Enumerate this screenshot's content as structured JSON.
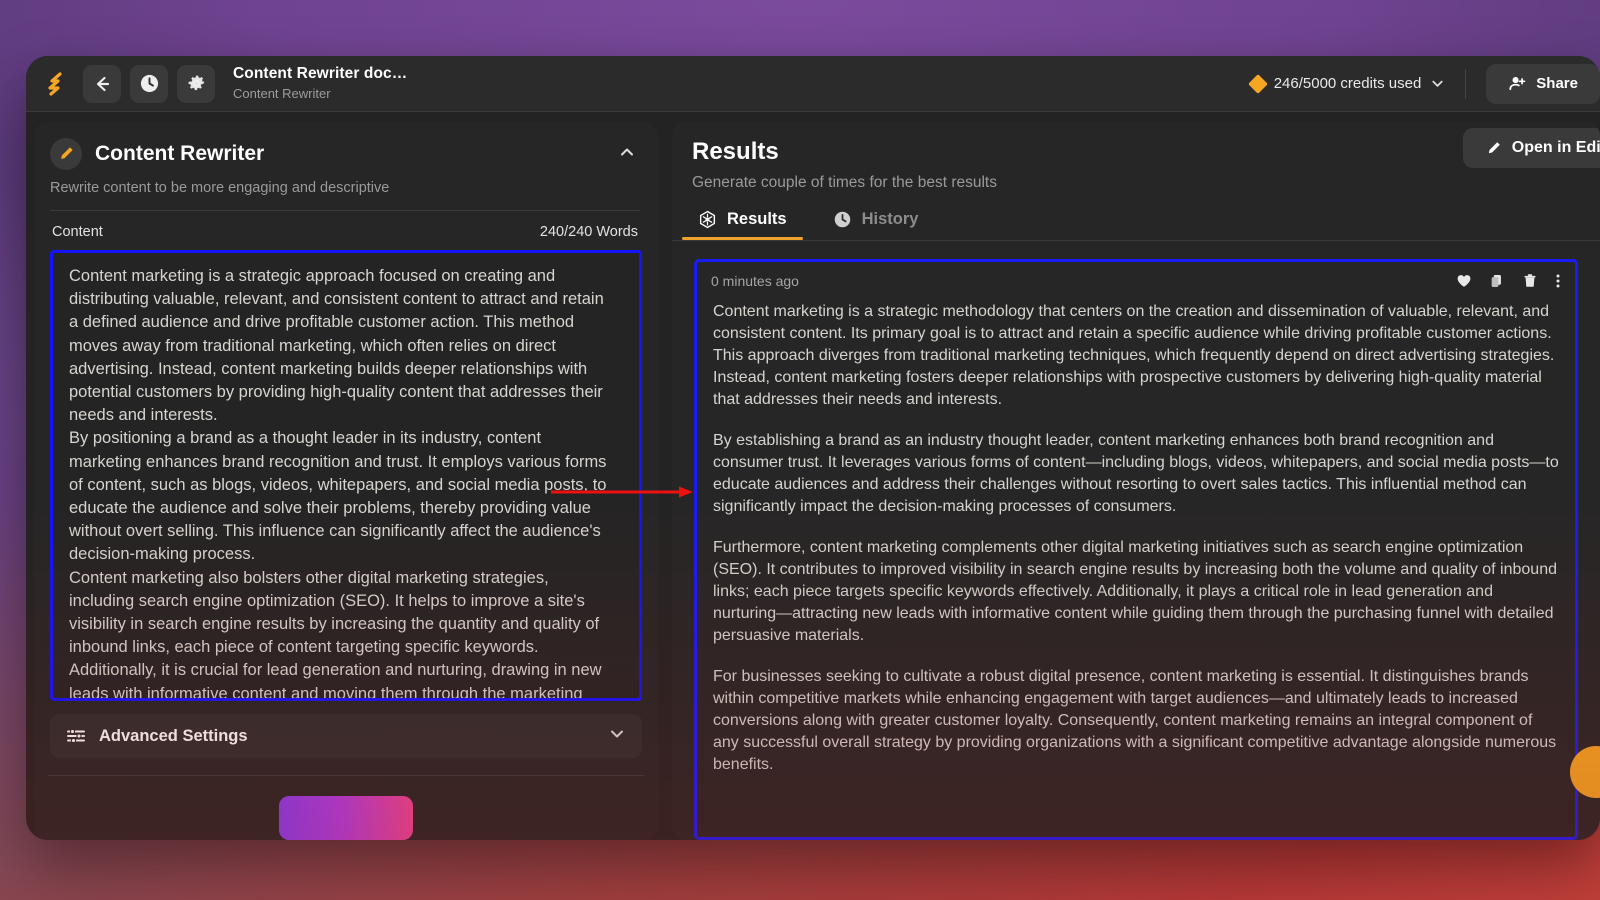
{
  "topbar": {
    "logo_icon": "brand-logo-icon",
    "back_icon": "back-arrow-icon",
    "history_icon": "clock-icon",
    "settings_icon": "gear-icon",
    "doc_title": "Content Rewriter doc…",
    "doc_subtitle": "Content Rewriter",
    "credits_label": "246/5000 credits used",
    "credits_used": 246,
    "credits_total": 5000,
    "credits_chevron_icon": "chevron-down-icon",
    "credits_badge_icon": "diamond-icon",
    "share_label": "Share",
    "share_icon": "user-plus-icon"
  },
  "left_panel": {
    "tool_icon": "pencil-icon",
    "title": "Content Rewriter",
    "collapse_icon": "chevron-up-icon",
    "description": "Rewrite content to be more engaging and descriptive",
    "field_label": "Content",
    "word_count": "240/240 Words",
    "content_value": "Content marketing is a strategic approach focused on creating and distributing valuable, relevant, and consistent content to attract and retain a defined audience and drive profitable customer action. This method moves away from traditional marketing, which often relies on direct advertising. Instead, content marketing builds deeper relationships with potential customers by providing high-quality content that addresses their needs and interests.\nBy positioning a brand as a thought leader in its industry, content marketing enhances brand recognition and trust. It employs various forms of content, such as blogs, videos, whitepapers, and social media posts, to educate the audience and solve their problems, thereby providing value without overt selling. This influence can significantly affect the audience's decision-making process.\nContent marketing also bolsters other digital marketing strategies, including search engine optimization (SEO). It helps to improve a site's visibility in search engine results by increasing the quantity and quality of inbound links, each piece of content targeting specific keywords. Additionally, it is crucial for lead generation and nurturing, drawing in new leads with informative content and moving them through the marketing funnel with detailed, persuasive materials.\nFor businesses aiming to establish a strong digital presence, content",
    "advanced_settings_label": "Advanced Settings",
    "advanced_settings_icon": "sliders-icon",
    "advanced_settings_chevron": "chevron-down-icon",
    "generate_button_label": ""
  },
  "right_panel": {
    "title": "Results",
    "description": "Generate couple of times for the best results",
    "open_in_editor_label": "Open in Editor",
    "open_in_editor_icon": "pencil-icon",
    "tabs": [
      {
        "label": "Results",
        "icon": "results-hex-icon",
        "active": true
      },
      {
        "label": "History",
        "icon": "clock-icon",
        "active": false
      }
    ],
    "result_card": {
      "timestamp": "0 minutes ago",
      "actions": [
        {
          "name": "favorite",
          "icon": "heart-icon"
        },
        {
          "name": "copy",
          "icon": "copy-icon"
        },
        {
          "name": "delete",
          "icon": "trash-icon"
        },
        {
          "name": "more",
          "icon": "more-vertical-icon"
        }
      ],
      "paragraphs": [
        "Content marketing is a strategic methodology that centers on the creation and dissemination of valuable, relevant, and consistent content. Its primary goal is to attract and retain a specific audience while driving profitable customer actions. This approach diverges from traditional marketing techniques, which frequently depend on direct advertising strategies. Instead, content marketing fosters deeper relationships with prospective customers by delivering high-quality material that addresses their needs and interests.",
        "By establishing a brand as an industry thought leader, content marketing enhances both brand recognition and consumer trust. It leverages various forms of content—including blogs, videos, whitepapers, and social media posts—to educate audiences and address their challenges without resorting to overt sales tactics. This influential method can significantly impact the decision-making processes of consumers.",
        "Furthermore, content marketing complements other digital marketing initiatives such as search engine optimization (SEO). It contributes to improved visibility in search engine results by increasing both the volume and quality of inbound links; each piece targets specific keywords effectively. Additionally, it plays a critical role in lead generation and nurturing—attracting new leads with informative content while guiding them through the purchasing funnel with detailed persuasive materials.",
        "For businesses seeking to cultivate a robust digital presence, content marketing is essential. It distinguishes brands within competitive markets while enhancing engagement with target audiences—and ultimately leads to increased conversions along with greater customer loyalty. Consequently, content marketing remains an integral component of any successful overall strategy by providing organizations with a significant competitive advantage alongside numerous benefits."
      ]
    },
    "help_fab_icon": "help-fab-icon"
  },
  "annotations": {
    "highlight_color": "#1b1bf5",
    "arrow_color": "#ee1111",
    "accent_color": "#f0a32a",
    "arrow_label": "mapping-arrow"
  }
}
